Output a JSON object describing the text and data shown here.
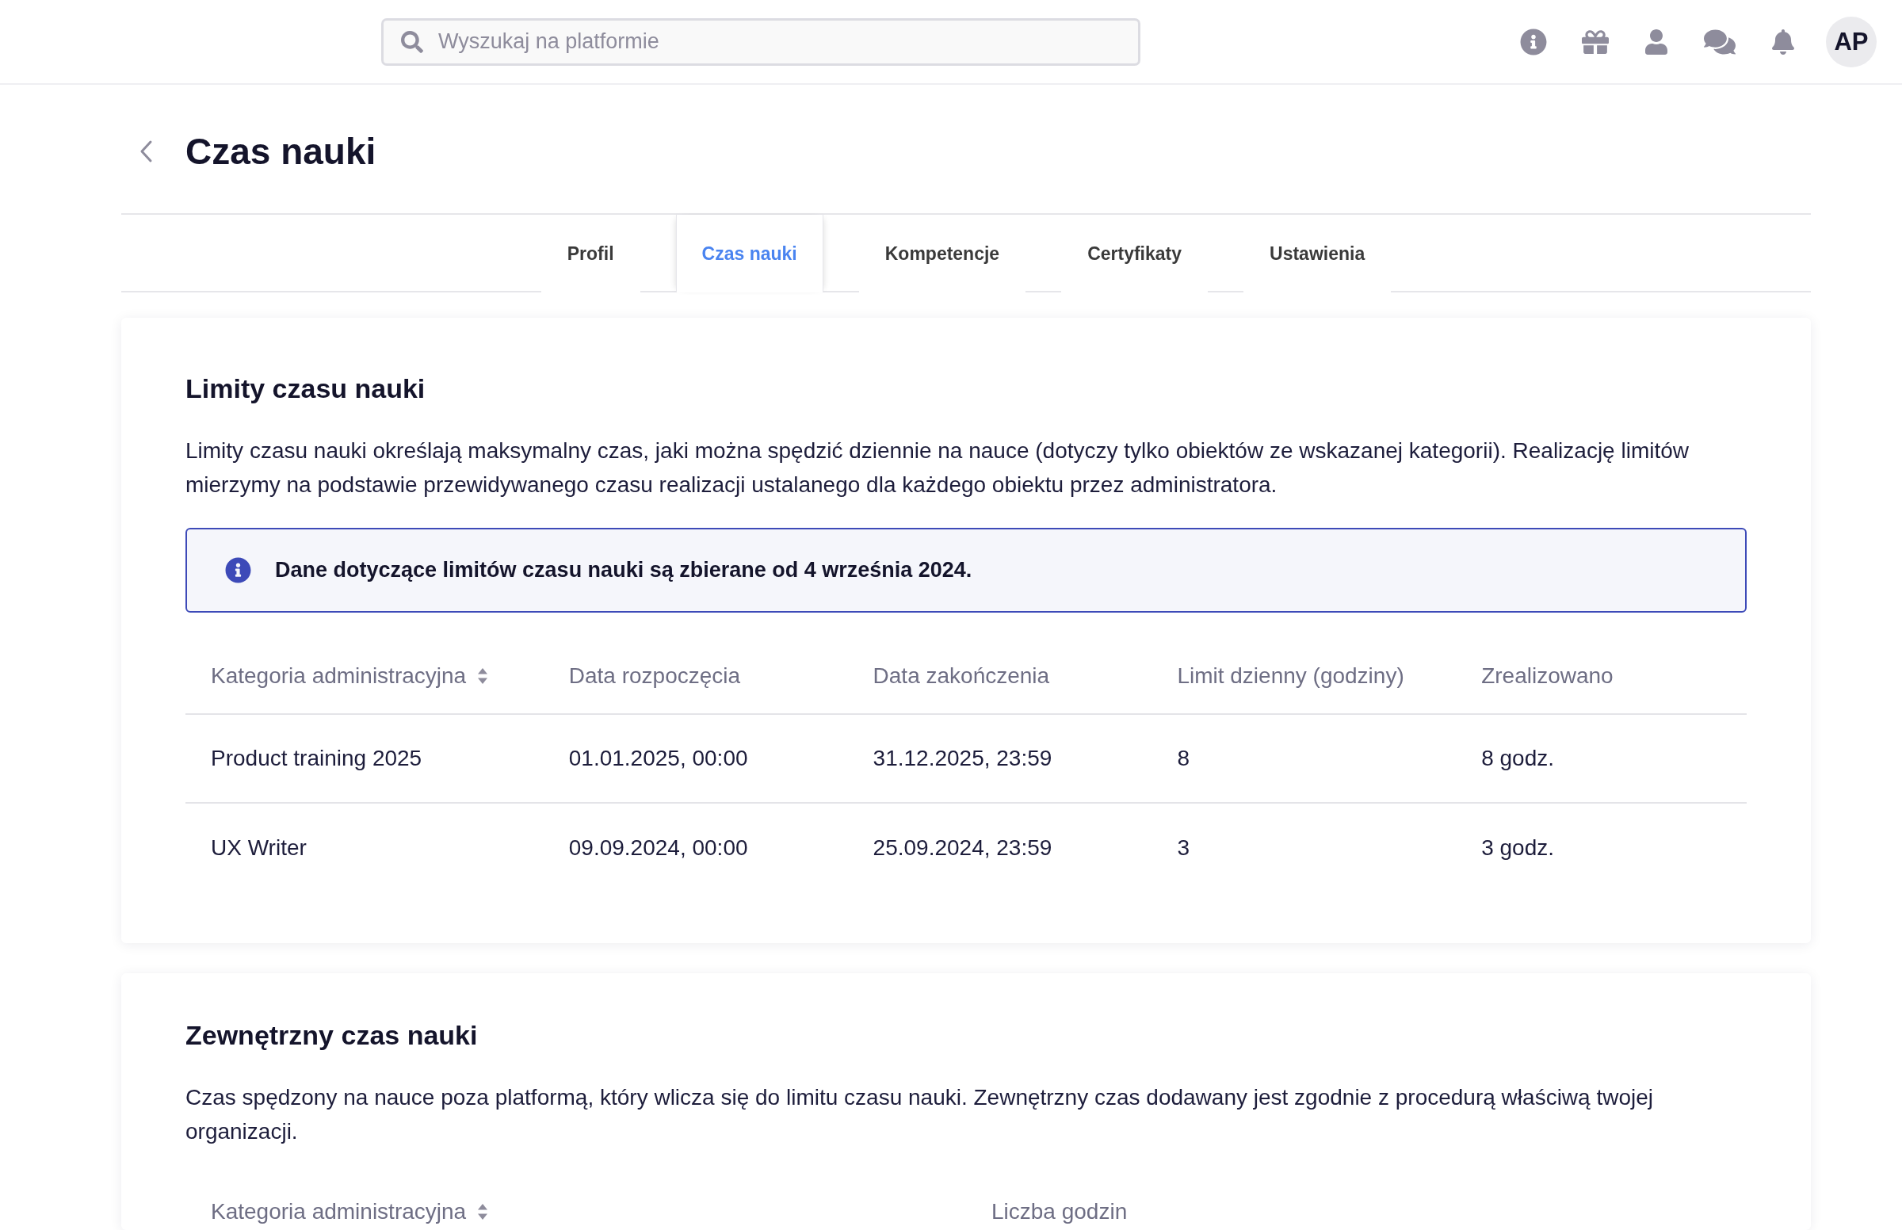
{
  "search": {
    "placeholder": "Wyszukaj na platformie"
  },
  "user": {
    "initials": "AP"
  },
  "page": {
    "title": "Czas nauki"
  },
  "tabs": [
    {
      "label": "Profil",
      "selected": false
    },
    {
      "label": "Czas nauki",
      "selected": true
    },
    {
      "label": "Kompetencje",
      "selected": false
    },
    {
      "label": "Certyfikaty",
      "selected": false
    },
    {
      "label": "Ustawienia",
      "selected": false
    }
  ],
  "sections": [
    {
      "title": "Limity czasu nauki",
      "description": "Limity czasu nauki określają maksymalny czas, jaki można spędzić dziennie na nauce (dotyczy tylko obiektów ze wskazanej kategorii). Realizację limitów mierzymy na podstawie przewidywanego czasu realizacji ustalanego dla każdego obiektu przez administratora.",
      "notice": "Dane dotyczące limitów czasu nauki są zbierane od 4 września 2024.",
      "table": {
        "columns": [
          {
            "label": "Kategoria administracyjna",
            "sortable": true
          },
          {
            "label": "Data rozpoczęcia",
            "sortable": false
          },
          {
            "label": "Data zakończenia",
            "sortable": false
          },
          {
            "label": "Limit dzienny (godziny)",
            "sortable": false
          },
          {
            "label": "Zrealizowano",
            "sortable": false
          }
        ],
        "rows": [
          [
            "Product training 2025",
            "01.01.2025, 00:00",
            "31.12.2025, 23:59",
            "8",
            "8 godz."
          ],
          [
            "UX Writer",
            "09.09.2024, 00:00",
            "25.09.2024, 23:59",
            "3",
            "3 godz."
          ]
        ]
      }
    },
    {
      "title": "Zewnętrzny czas nauki",
      "description": "Czas spędzony na nauce poza platformą, który wlicza się do limitu czasu nauki. Zewnętrzny czas dodawany jest zgodnie z procedurą właściwą twojej organizacji.",
      "table": {
        "columns": [
          {
            "label": "Kategoria administracyjna",
            "sortable": true
          },
          {
            "label": "Liczba godzin",
            "sortable": false
          }
        ]
      }
    }
  ]
}
